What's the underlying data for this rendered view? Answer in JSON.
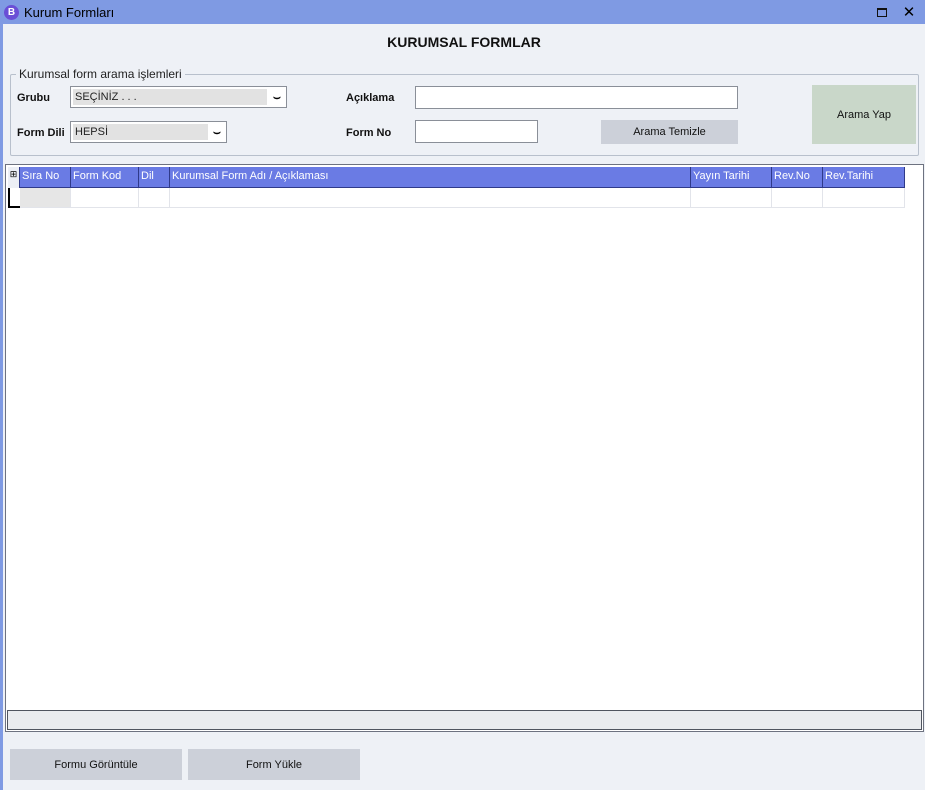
{
  "window": {
    "icon_letter": "B",
    "title": "Kurum Formları",
    "maximize_icon": "maximize-icon",
    "close_glyph": "✕"
  },
  "header": {
    "title": "KURUMSAL FORMLAR"
  },
  "search": {
    "group_label": "Kurumsal form arama işlemleri",
    "grubu_label": "Grubu",
    "grubu_value": "SEÇİNİZ . . .",
    "form_dili_label": "Form Dili",
    "form_dili_value": "HEPSİ",
    "dropdown_glyph": "⌣",
    "aciklama_label": "Açıklama",
    "aciklama_value": "",
    "form_no_label": "Form No",
    "form_no_value": "",
    "search_button": "Arama Yap",
    "clear_button": "Arama Temizle"
  },
  "grid": {
    "corner_glyph": "⊞",
    "columns": [
      "Sıra No",
      "Form Kod",
      "Dil",
      "Kurumsal Form Adı / Açıklaması",
      "Yayın Tarihi",
      "Rev.No",
      "Rev.Tarihi"
    ],
    "rows": []
  },
  "footer": {
    "view_button": "Formu Görüntüle",
    "upload_button": "Form Yükle"
  },
  "colors": {
    "titlebar": "#7f9ae3",
    "grid_header": "#6a7be4",
    "search_button_bg": "#c9d7c9",
    "button_bg": "#ccd0d9"
  }
}
